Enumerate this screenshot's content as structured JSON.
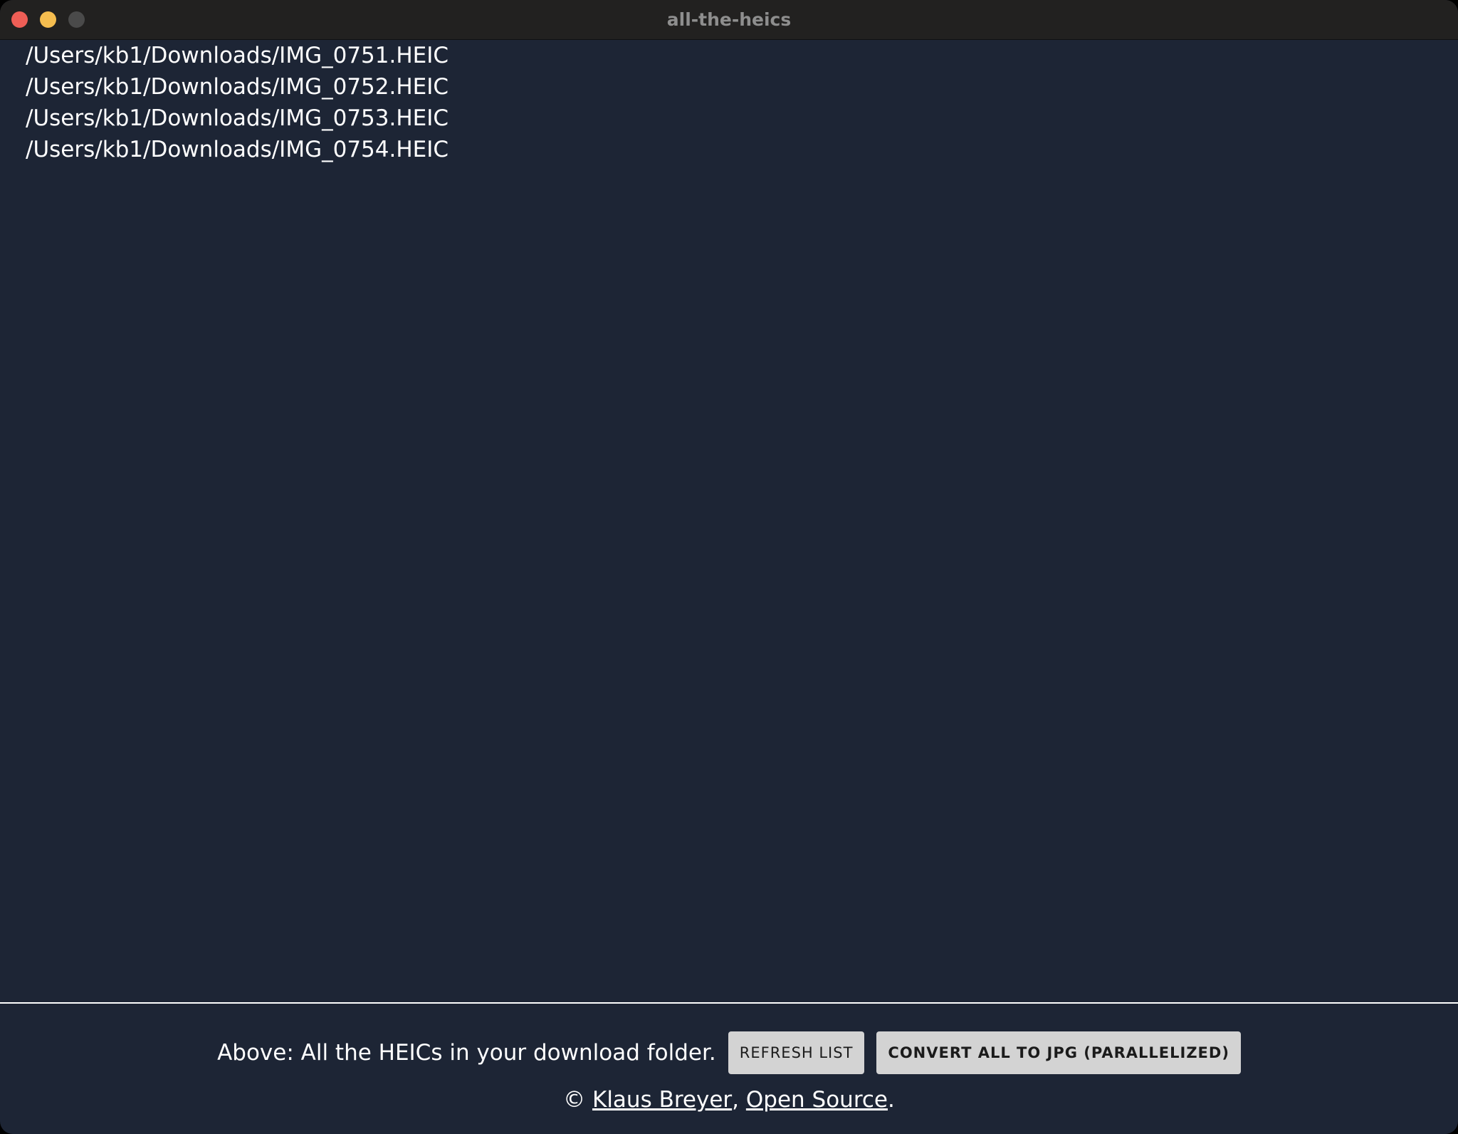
{
  "window": {
    "title": "all-the-heics"
  },
  "file_list": [
    "/Users/kb1/Downloads/IMG_0751.HEIC",
    "/Users/kb1/Downloads/IMG_0752.HEIC",
    "/Users/kb1/Downloads/IMG_0753.HEIC",
    "/Users/kb1/Downloads/IMG_0754.HEIC"
  ],
  "footer": {
    "description": "Above: All the HEICs in your download folder.",
    "refresh_label": "REFRESH LIST",
    "convert_label": "CONVERT ALL TO JPG (PARALLELIZED)",
    "copyright_symbol": "©",
    "author_link": "Klaus Breyer",
    "separator": ",",
    "open_source_link": "Open Source",
    "end_period": "."
  },
  "colors": {
    "background": "#1d2535",
    "titlebar": "#222120",
    "button": "#d3d3d3",
    "close": "#ee5e56",
    "minimize": "#f5bd4f",
    "zoom_inactive": "#4a4a4a"
  },
  "icons": {
    "close": "close-dot-icon",
    "minimize": "minimize-dot-icon",
    "zoom": "zoom-dot-icon"
  }
}
